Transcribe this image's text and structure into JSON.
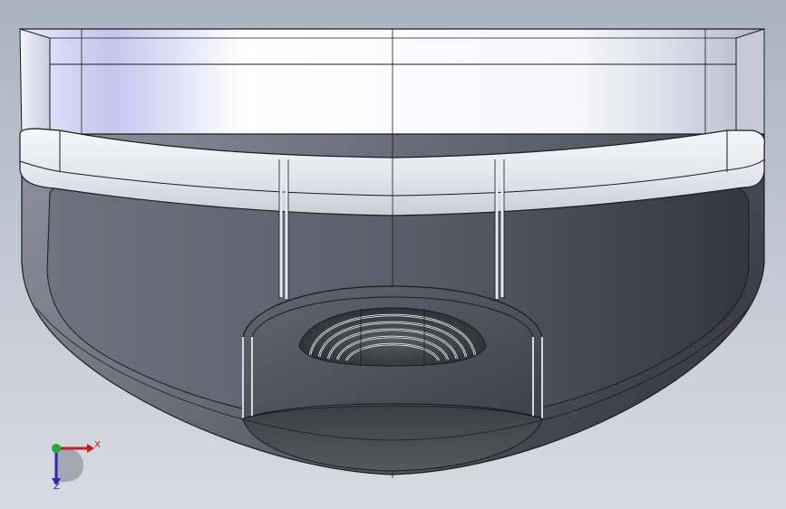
{
  "viewport": {
    "background_top": "#a9b3c1",
    "background_bottom": "#d6dbe2"
  },
  "model": {
    "body_color": "#f4f5fb",
    "body_highlight": "#b9bde8",
    "shell_dark": "#4a4d56",
    "shell_mid": "#7c7f89",
    "edge_color": "#1c1c1c"
  },
  "triad": {
    "x_label": "X",
    "z_label": "Z",
    "x_color": "#c81e1e",
    "y_color": "#1faa3a",
    "z_color": "#2a2aa8"
  }
}
